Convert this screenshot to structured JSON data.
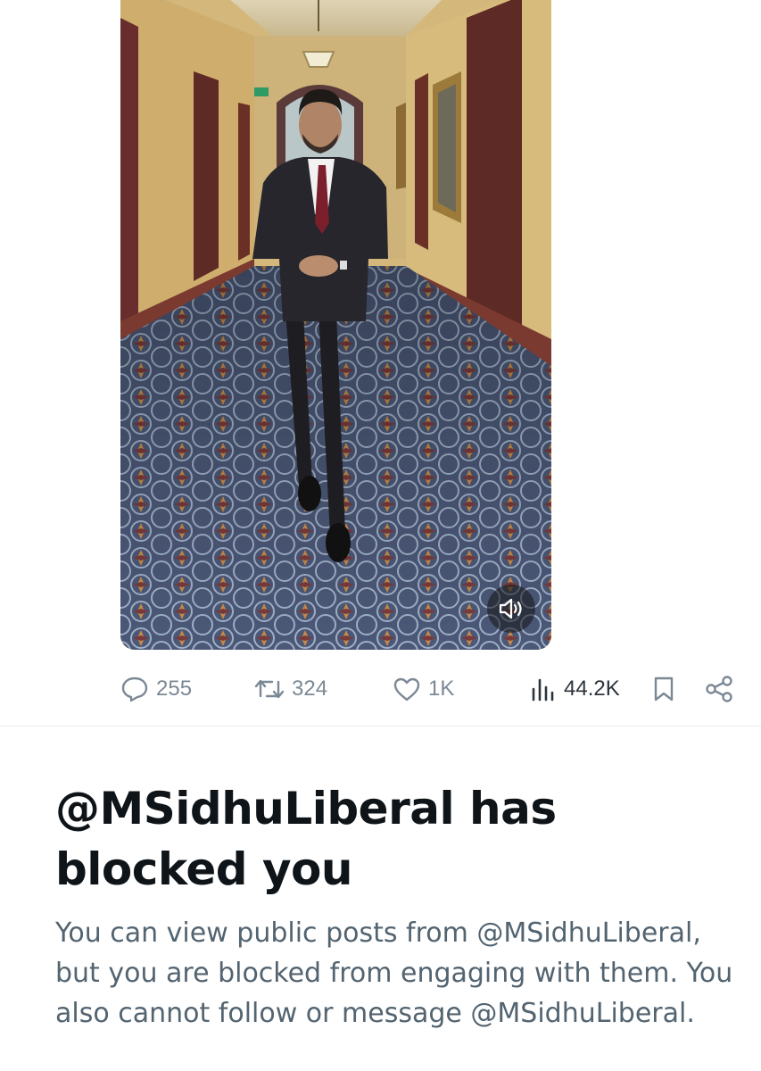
{
  "media": {
    "description_icon": "video-thumbnail",
    "volume_icon": "speaker-icon"
  },
  "actions": {
    "replies": {
      "icon": "reply-icon",
      "count": "255"
    },
    "reposts": {
      "icon": "repost-icon",
      "count": "324"
    },
    "likes": {
      "icon": "heart-icon",
      "count": "1K"
    },
    "views": {
      "icon": "views-icon",
      "count": "44.2K"
    },
    "bookmark": {
      "icon": "bookmark-icon"
    },
    "share": {
      "icon": "share-icon"
    }
  },
  "block_notice": {
    "title": "@MSidhuLiberal has blocked you",
    "body": "You can view public posts from @MSidhuLiberal, but you are blocked from engaging with them. You also cannot follow or message @MSidhuLiberal."
  },
  "colors": {
    "muted_text": "#536471",
    "icon_gray": "#7b8895",
    "title_text": "#0f1419",
    "divider": "#e6e9ec"
  }
}
